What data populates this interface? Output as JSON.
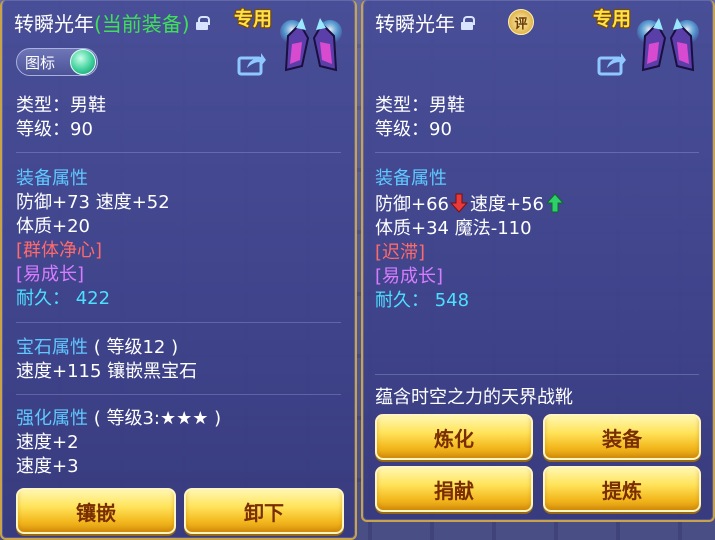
{
  "left_panel": {
    "title_name": "转瞬光年",
    "title_current": "(当前装备)",
    "exclusive_badge": "专用",
    "toggle_label": "图标",
    "type_line": "类型：男鞋",
    "level_line": "等级：90",
    "attr_header": "装备属性",
    "attr_line1": "防御+73 速度+52",
    "attr_line2": "体质+20",
    "special_skill": "[群体净心]",
    "special_effect": "[易成长]",
    "durability_label": "耐久：",
    "durability_value": "422",
    "gem_header": "宝石属性",
    "gem_level": "( 等级12 )",
    "gem_line": "速度+115 镶嵌黑宝石",
    "enhance_header": "强化属性",
    "enhance_level": "( 等级3:★★★ )",
    "enhance_line1": "速度+2",
    "enhance_line2": "速度+3",
    "btn_inlay": "镶嵌",
    "btn_unequip": "卸下"
  },
  "right_panel": {
    "title_name": "转瞬光年",
    "rate_label": "评",
    "exclusive_badge": "专用",
    "type_line": "类型：男鞋",
    "level_line": "等级：90",
    "attr_header": "装备属性",
    "attr_defense": "防御+66",
    "attr_speed": "速度+56",
    "attr_line2": "体质+34 魔法-110",
    "special_skill": "[迟滞]",
    "special_effect": "[易成长]",
    "durability_label": "耐久：",
    "durability_value": "548",
    "description": "蕴含时空之力的天界战靴",
    "btn_refine": "炼化",
    "btn_equip": "装备",
    "btn_donate": "捐献",
    "btn_extract": "提炼"
  },
  "colors": {
    "panel_border": "#c9a34a",
    "section_header": "#5fc8ff",
    "current_tag": "#3ee05a",
    "skill_red": "#ff6a6a",
    "effect_purple": "#d77cff",
    "durability_cyan": "#4ce0ff",
    "badge_yellow": "#ffe14a",
    "button_gold": "#ffe35a",
    "decrease_arrow": "#e83a3a",
    "increase_arrow": "#2fd06a"
  },
  "icons": [
    "lock-icon",
    "boot-icon",
    "share-icon",
    "toggle-knob",
    "rate-icon",
    "arrow-down-icon",
    "arrow-up-icon"
  ]
}
